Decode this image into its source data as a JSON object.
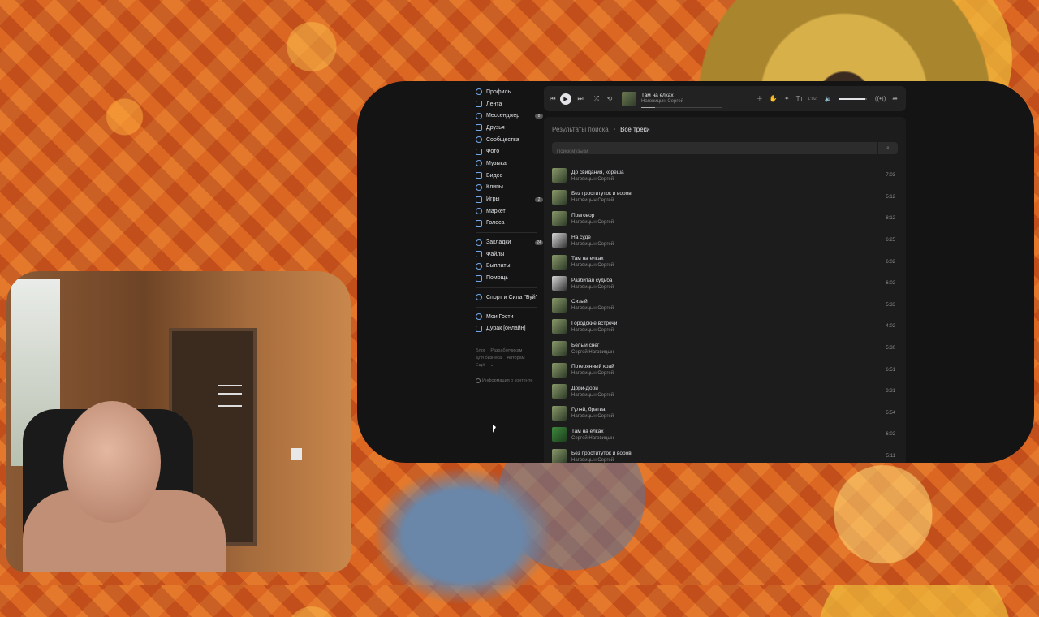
{
  "sidebar": {
    "items": [
      {
        "label": "Профиль",
        "icon": "user-circle-icon"
      },
      {
        "label": "Лента",
        "icon": "feed-icon"
      },
      {
        "label": "Мессенджер",
        "icon": "message-icon",
        "badge": "8"
      },
      {
        "label": "Друзья",
        "icon": "friends-icon"
      },
      {
        "label": "Сообщества",
        "icon": "communities-icon"
      },
      {
        "label": "Фото",
        "icon": "photo-icon"
      },
      {
        "label": "Музыка",
        "icon": "music-icon"
      },
      {
        "label": "Видео",
        "icon": "video-icon"
      },
      {
        "label": "Клипы",
        "icon": "clips-icon"
      },
      {
        "label": "Игры",
        "icon": "games-icon",
        "badge": "2"
      },
      {
        "label": "Маркет",
        "icon": "market-icon"
      },
      {
        "label": "Голоса",
        "icon": "votes-icon"
      }
    ],
    "items2": [
      {
        "label": "Закладки",
        "icon": "bookmark-icon",
        "badge": "24"
      },
      {
        "label": "Файлы",
        "icon": "files-icon"
      },
      {
        "label": "Выплаты",
        "icon": "payments-icon"
      },
      {
        "label": "Помощь",
        "icon": "help-icon"
      }
    ],
    "items3": [
      {
        "label": "Спорт и Сила \"Буй\"",
        "icon": "community-icon"
      }
    ],
    "items4": [
      {
        "label": "Мои Гости",
        "icon": "app-icon"
      },
      {
        "label": "Дурак [онлайн]",
        "icon": "app-icon"
      }
    ],
    "footer": [
      "Блог",
      "Разработчикам",
      "Для бизнеса",
      "Авторам",
      "Ещё"
    ],
    "content_info": "Информация о контенте"
  },
  "player": {
    "title": "Там на елках",
    "artist": "Наговицын Сергей",
    "time": "1:02",
    "progress": 0.17,
    "volume": 0.95
  },
  "main": {
    "breadcrumb_parent": "Результаты поиска",
    "breadcrumb_current": "Все треки",
    "search_placeholder": "Поиск музыки"
  },
  "tracks": [
    {
      "title": "До свидания, кореша",
      "artist": "Наговицын Сергей",
      "duration": "7:03",
      "cover": "normal"
    },
    {
      "title": "Без проституток и воров",
      "artist": "Наговицын Сергей",
      "duration": "5:12",
      "cover": "normal"
    },
    {
      "title": "Приговор",
      "artist": "Наговицын Сергей",
      "duration": "8:12",
      "cover": "normal"
    },
    {
      "title": "На суде",
      "artist": "Наговицын Сергей",
      "duration": "6:25",
      "cover": "alt"
    },
    {
      "title": "Там на елках",
      "artist": "Наговицын Сергей",
      "duration": "6:02",
      "cover": "normal"
    },
    {
      "title": "Разбитая судьба",
      "artist": "Наговицын Сергей",
      "duration": "6:02",
      "cover": "alt"
    },
    {
      "title": "Сизый",
      "artist": "Наговицын Сергей",
      "duration": "5:33",
      "cover": "normal"
    },
    {
      "title": "Городские встречи",
      "artist": "Наговицын Сергей",
      "duration": "4:02",
      "cover": "normal"
    },
    {
      "title": "Белый снег",
      "artist": "Сергей Наговицын",
      "duration": "5:30",
      "cover": "normal"
    },
    {
      "title": "Потерянный край",
      "artist": "Наговицын Сергей",
      "duration": "6:51",
      "cover": "normal"
    },
    {
      "title": "Дори-Дори",
      "artist": "Наговицын Сергей",
      "duration": "3:31",
      "cover": "normal"
    },
    {
      "title": "Гуляй, братва",
      "artist": "Наговицын Сергей",
      "duration": "5:54",
      "cover": "normal"
    },
    {
      "title": "Там на елках",
      "artist": "Сергей Наговицын",
      "duration": "6:02",
      "cover": "green"
    },
    {
      "title": "Без проституток и воров",
      "artist": "Наговицын Сергей",
      "duration": "5:11",
      "cover": "normal"
    }
  ]
}
